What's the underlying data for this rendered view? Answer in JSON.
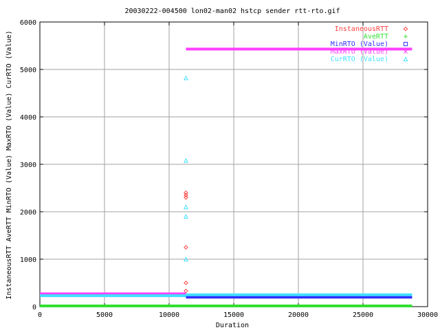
{
  "chart_data": {
    "type": "scatter",
    "title": "20030222-004500 lon02-man02 hstcp sender rtt-rto.gif",
    "xlabel": "Duration",
    "ylabel": "InstaneousRTT AveRTT MinRTO (Value) MaxRTO (Value) CurRTO (Value)",
    "xlim": [
      0,
      30000
    ],
    "ylim": [
      0,
      6000
    ],
    "x_ticks": [
      0,
      5000,
      10000,
      15000,
      20000,
      25000,
      30000
    ],
    "y_ticks": [
      0,
      1000,
      2000,
      3000,
      4000,
      5000,
      6000
    ],
    "grid": true,
    "legend_position": "top-right",
    "series": [
      {
        "name": "InstaneousRTT",
        "color": "#ff4040",
        "marker": "diamond",
        "segments": [
          {
            "x_start": 0,
            "x_end": 11300,
            "y": 260
          }
        ],
        "points": [
          [
            11300,
            330
          ],
          [
            11300,
            500
          ],
          [
            11300,
            1250
          ],
          [
            11300,
            2300
          ],
          [
            11300,
            2350
          ],
          [
            11300,
            2400
          ]
        ]
      },
      {
        "name": "AveRTT",
        "color": "#30e030",
        "marker": "plus",
        "segments": [
          {
            "x_start": 0,
            "x_end": 28800,
            "y": 15
          }
        ],
        "points": []
      },
      {
        "name": "MinRTO (Value)",
        "color": "#3030ff",
        "marker": "square",
        "segments": [
          {
            "x_start": 11300,
            "x_end": 28800,
            "y": 200
          }
        ],
        "points": []
      },
      {
        "name": "MaxRTO (Value)",
        "color": "#ff40ff",
        "marker": "x",
        "segments": [
          {
            "x_start": 0,
            "x_end": 11300,
            "y": 270
          },
          {
            "x_start": 11300,
            "x_end": 28800,
            "y": 5430
          }
        ],
        "points": []
      },
      {
        "name": "CurRTO (Value)",
        "color": "#40e0ff",
        "marker": "triangle",
        "segments": [
          {
            "x_start": 0,
            "x_end": 11300,
            "y": 230
          },
          {
            "x_start": 11300,
            "x_end": 28800,
            "y": 250
          }
        ],
        "points": [
          [
            11300,
            1000
          ],
          [
            11300,
            1900
          ],
          [
            11300,
            2100
          ],
          [
            11300,
            3080
          ],
          [
            11300,
            4820
          ]
        ]
      }
    ]
  }
}
